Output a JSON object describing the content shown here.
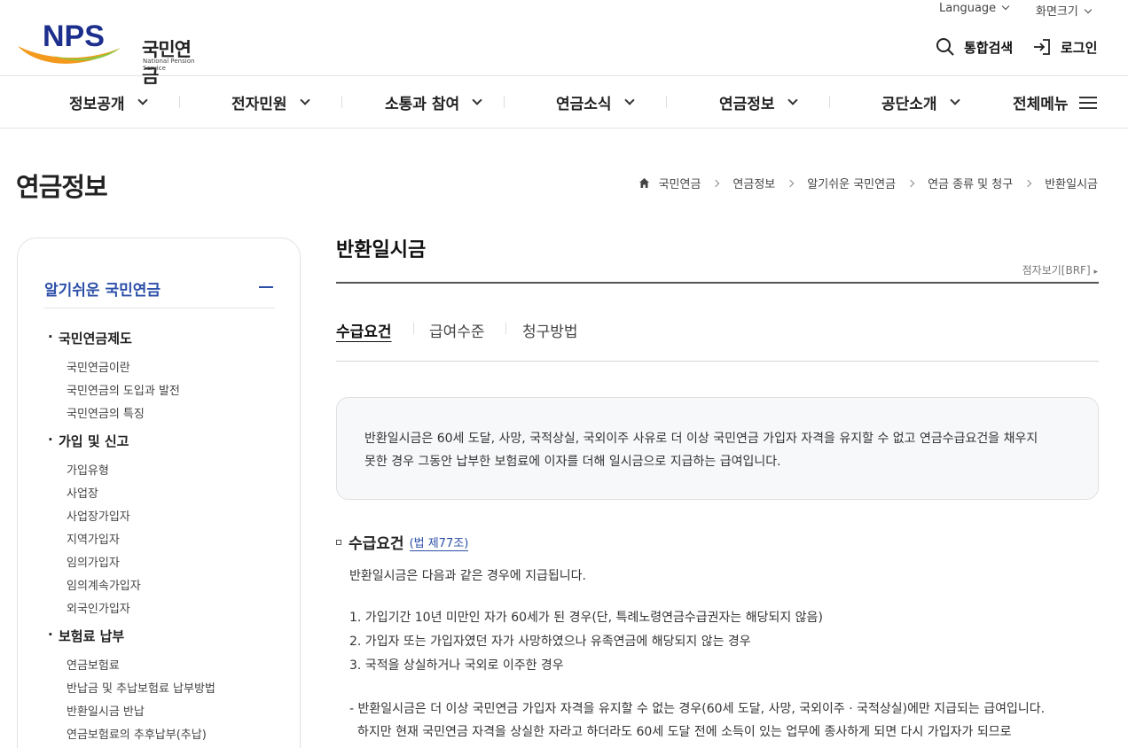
{
  "header": {
    "logo_text": "NPS",
    "logo_korean": "국민연금",
    "logo_english": "National Pension Service",
    "language_label": "Language",
    "screen_size_label": "화면크기",
    "search_label": "통합검색",
    "login_label": "로그인"
  },
  "gnb": {
    "items": [
      "정보공개",
      "전자민원",
      "소통과 참여",
      "연금소식",
      "연금정보",
      "공단소개"
    ],
    "all_menu_label": "전체메뉴"
  },
  "page": {
    "title": "연금정보",
    "breadcrumb": [
      "국민연금",
      "연금정보",
      "알기쉬운 국민연금",
      "연금 종류 및 청구",
      "반환일시금"
    ]
  },
  "sidebar": {
    "title": "알기쉬운 국민연금",
    "groups": [
      {
        "label": "국민연금제도",
        "items": [
          "국민연금이란",
          "국민연금의 도입과 발전",
          "국민연금의 특징"
        ]
      },
      {
        "label": "가입 및 신고",
        "items": [
          "가입유형",
          "사업장",
          "사업장가입자",
          "지역가입자",
          "임의가입자",
          "임의계속가입자",
          "외국인가입자"
        ]
      },
      {
        "label": "보험료 납부",
        "items": [
          "연금보험료",
          "반납금 및 추납보험료 납부방법",
          "반환일시금 반납",
          "연금보험료의 추후납부(추납)"
        ]
      }
    ]
  },
  "content": {
    "title": "반환일시금",
    "brf_label": "점자보기[BRF]",
    "tabs": [
      "수급요건",
      "급여수준",
      "청구방법"
    ],
    "summary_line1": "반환일시금은 60세 도달, 사망, 국적상실, 국외이주 사유로 더 이상 국민연금 가입자 자격을 유지할 수 없고 연금수급요건을 채우지",
    "summary_line2": "못한 경우 그동안 납부한 보험료에 이자를 더해 일시금으로 지급하는 급여입니다.",
    "section_title": "수급요건",
    "law_link": "(법 제77조)",
    "intro": "반환일시금은 다음과 같은 경우에 지급됩니다.",
    "conditions": [
      "1. 가입기간 10년 미만인 자가 60세가 된 경우(단, 특례노령연금수급권자는 해당되지 않음)",
      "2. 가입자 또는 가입자였던 자가 사망하였으나 유족연금에 해당되지 않는 경우",
      "3. 국적을 상실하거나 국외로 이주한 경우"
    ],
    "note_line1": "- 반환일시금은 더 이상 국민연금 가입자 자격을 유지할 수 없는 경우(60세 도달, 사망, 국외이주 · 국적상실)에만 지급되는 급여입니다.",
    "note_line2": "하지만 현재 국민연금 자격을 상실한 자라고 하더라도 60세 도달 전에 소득이 있는 업무에 종사하게 되면 다시 가입자가 되므로"
  },
  "colors": {
    "brand_blue": "#2c4fa8",
    "logo_orange": "#f39a1e",
    "logo_green": "#8cc63f"
  }
}
